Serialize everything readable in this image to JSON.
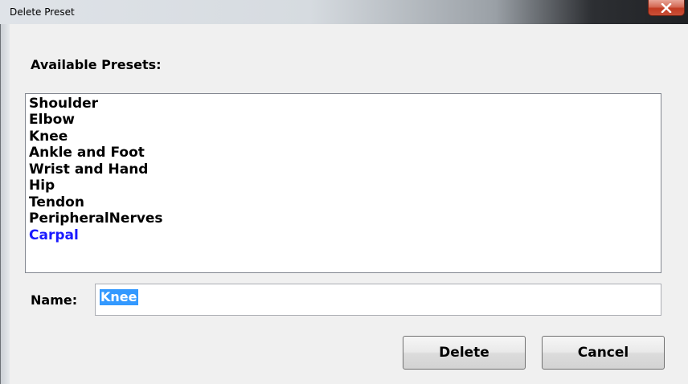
{
  "window": {
    "title": "Delete Preset",
    "close_glyph": "✕"
  },
  "presets": {
    "label": "Available Presets:",
    "items": [
      {
        "label": "Shoulder",
        "color": "#000000"
      },
      {
        "label": "Elbow",
        "color": "#000000"
      },
      {
        "label": "Knee",
        "color": "#000000"
      },
      {
        "label": "Ankle and Foot",
        "color": "#000000"
      },
      {
        "label": "Wrist and Hand",
        "color": "#000000"
      },
      {
        "label": "Hip",
        "color": "#000000"
      },
      {
        "label": "Tendon",
        "color": "#000000"
      },
      {
        "label": "PeripheralNerves",
        "color": "#000000"
      },
      {
        "label": "Carpal",
        "color": "#1a1aff"
      }
    ]
  },
  "name_field": {
    "label": "Name:",
    "value": "Knee"
  },
  "buttons": {
    "delete_label": "Delete",
    "cancel_label": "Cancel"
  },
  "colors": {
    "selection_bg": "#3399ff",
    "highlight_item": "#1a1aff"
  }
}
